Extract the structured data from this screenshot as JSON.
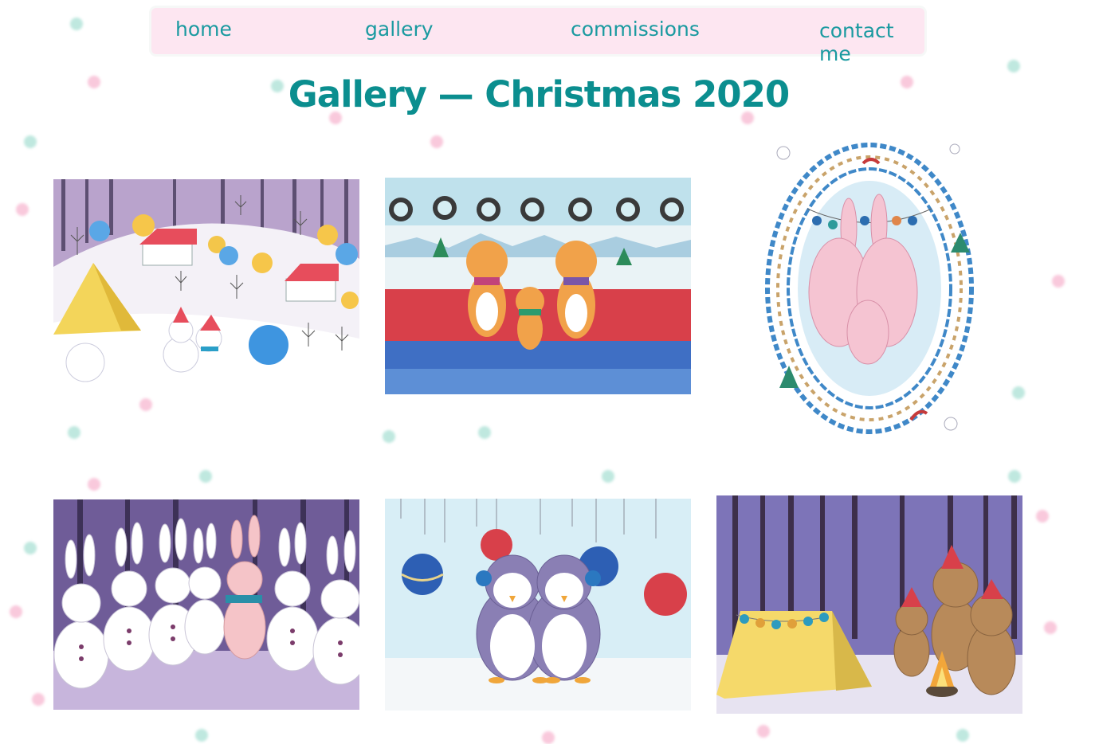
{
  "nav": {
    "home": "home",
    "gallery": "gallery",
    "commissions": "commissions",
    "contact": "contact me"
  },
  "page": {
    "title": "Gallery — Christmas 2020"
  },
  "gallery": [
    {
      "name": "winter-village-snowman-painting"
    },
    {
      "name": "tiger-family-sofa-painting"
    },
    {
      "name": "bunny-family-wreath-painting"
    },
    {
      "name": "snow-bunnies-forest-painting"
    },
    {
      "name": "penguin-couple-ornaments-painting"
    },
    {
      "name": "bears-campfire-tent-painting"
    }
  ],
  "colors": {
    "nav_bg": "#fde6f1",
    "nav_text": "#1a9aa0",
    "title": "#0b8e8f",
    "confetti_pink": "#f9c9dc",
    "confetti_teal": "#bfe8df"
  }
}
